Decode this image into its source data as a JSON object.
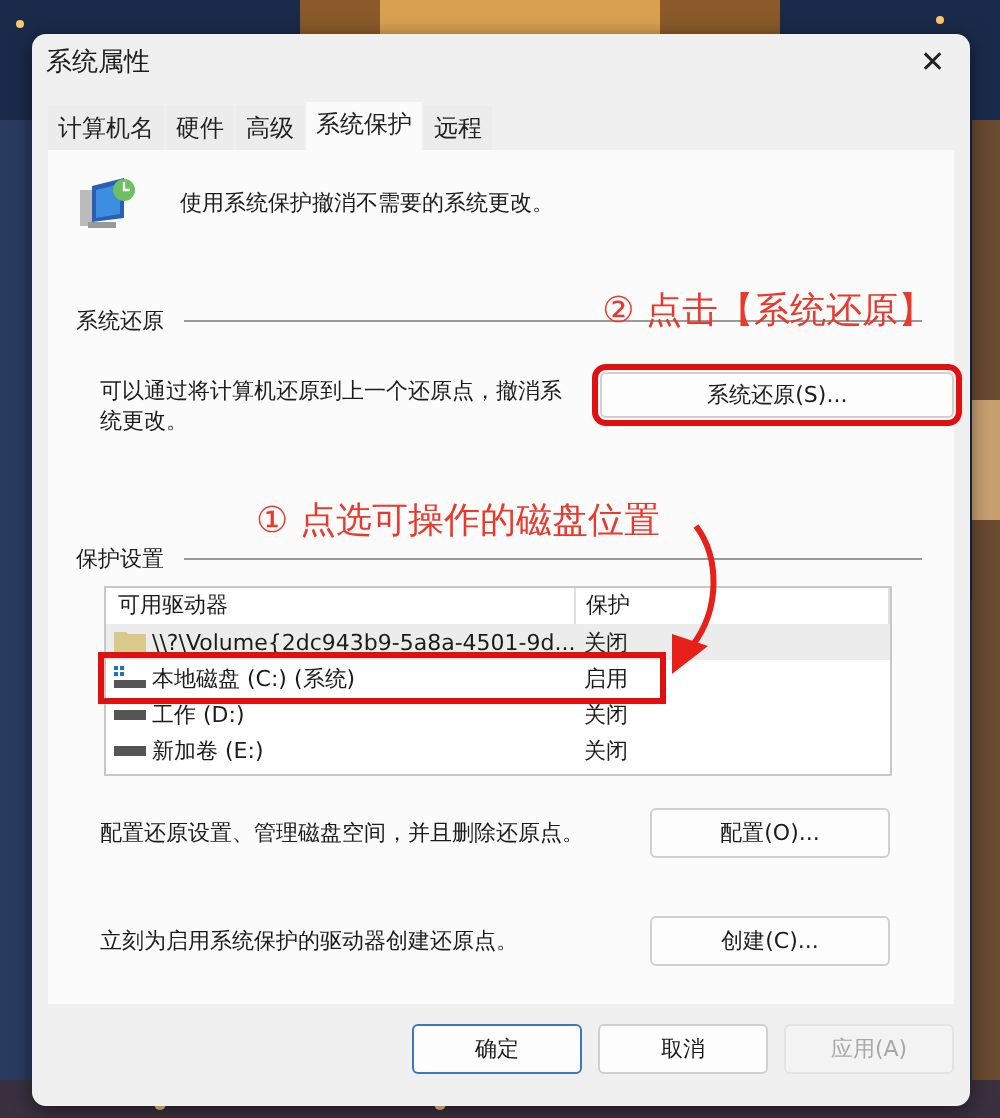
{
  "window": {
    "title": "系统属性",
    "close": "✕"
  },
  "tabs": [
    {
      "label": "计算机名",
      "selected": false
    },
    {
      "label": "硬件",
      "selected": false
    },
    {
      "label": "高级",
      "selected": false
    },
    {
      "label": "系统保护",
      "selected": true
    },
    {
      "label": "远程",
      "selected": false
    }
  ],
  "intro": "使用系统保护撤消不需要的系统更改。",
  "restore": {
    "heading": "系统还原",
    "description": "可以通过将计算机还原到上一个还原点，撤消系统更改。",
    "button": {
      "label": "系统还原(S)...",
      "highlighted": true
    }
  },
  "protection": {
    "heading": "保护设置",
    "columns": [
      "可用驱动器",
      "保护"
    ],
    "rows": [
      {
        "kind": "folder",
        "drive": "\\\\?\\Volume{2dc943b9-5a8a-4501-9d...",
        "status": "关闭",
        "selected": true,
        "highlighted": false
      },
      {
        "kind": "system-drive",
        "drive": "本地磁盘 (C:) (系统)",
        "status": "启用",
        "selected": false,
        "highlighted": true
      },
      {
        "kind": "drive",
        "drive": "工作 (D:)",
        "status": "关闭",
        "selected": false,
        "highlighted": false
      },
      {
        "kind": "drive",
        "drive": "新加卷 (E:)",
        "status": "关闭",
        "selected": false,
        "highlighted": false
      }
    ]
  },
  "actions": [
    {
      "description": "配置还原设置、管理磁盘空间，并且删除还原点。",
      "button": "配置(O)..."
    },
    {
      "description": "立刻为启用系统保护的驱动器创建还原点。",
      "button": "创建(C)..."
    }
  ],
  "annotations": [
    "② 点击【系统还原】",
    "① 点选可操作的磁盘位置"
  ],
  "footer": [
    {
      "label": "确定",
      "default": true,
      "disabled": false
    },
    {
      "label": "取消",
      "default": false,
      "disabled": false
    },
    {
      "label": "应用(A)",
      "default": false,
      "disabled": true
    }
  ]
}
